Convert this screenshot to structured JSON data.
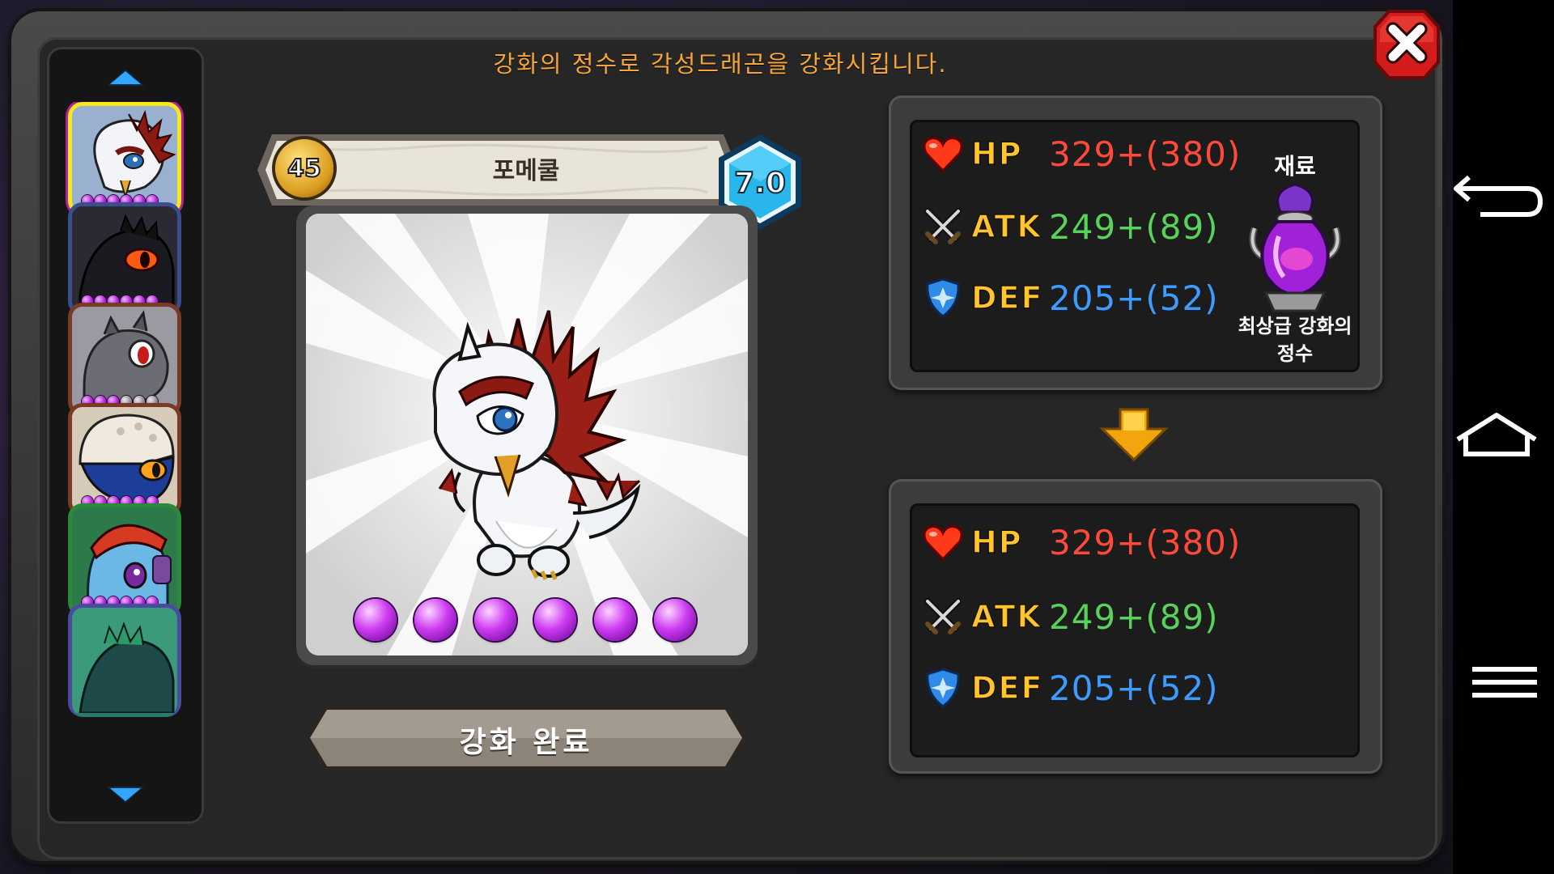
{
  "instruction": "강화의 정수로 각성드래곤을 강화시킵니다.",
  "dragon": {
    "level": "45",
    "name": "포메쿨",
    "grade": "7.0",
    "gem_count": 6
  },
  "complete_button": "강화 완료",
  "sidebar": {
    "portraits": [
      {
        "name": "pomekul",
        "gems_filled": 6,
        "gems_total": 6,
        "selected": true
      },
      {
        "name": "dark-dragon",
        "gems_filled": 6,
        "gems_total": 6,
        "selected": false
      },
      {
        "name": "grey-dragon",
        "gems_filled": 3,
        "gems_total": 6,
        "selected": false
      },
      {
        "name": "bone-helmet-dragon",
        "gems_filled": 6,
        "gems_total": 6,
        "selected": false
      },
      {
        "name": "ice-dragon",
        "gems_filled": 6,
        "gems_total": 6,
        "selected": false
      },
      {
        "name": "green-dragon",
        "gems_filled": 6,
        "gems_total": 6,
        "selected": false
      }
    ]
  },
  "current_stats": {
    "hp_label": "HP",
    "hp_value": "329+(380)",
    "atk_label": "ATK",
    "atk_value": "249+(89)",
    "def_label": "DEF",
    "def_value": "205+(52)"
  },
  "material": {
    "label": "재료",
    "name_line1": "최상급 강화의",
    "name_line2": "정수"
  },
  "result_stats": {
    "hp_label": "HP",
    "hp_value": "329+(380)",
    "atk_label": "ATK",
    "atk_value": "249+(89)",
    "def_label": "DEF",
    "def_value": "205+(52)"
  },
  "colors": {
    "instruction": "#f7a53a",
    "hp": "#ff4a3a",
    "atk": "#58d25a",
    "def": "#3c9cff",
    "stat_label": "#ffc531",
    "selected_border": "#f6e81b"
  },
  "icons": {
    "close": "close-x-icon",
    "up": "arrow-up-icon",
    "down": "arrow-down-icon",
    "hp": "heart-icon",
    "atk": "crossed-swords-icon",
    "def": "shield-icon",
    "transition": "down-arrow-icon",
    "material": "essence-potion-icon",
    "nav_back": "back-icon",
    "nav_home": "home-icon",
    "nav_menu": "menu-icon"
  }
}
